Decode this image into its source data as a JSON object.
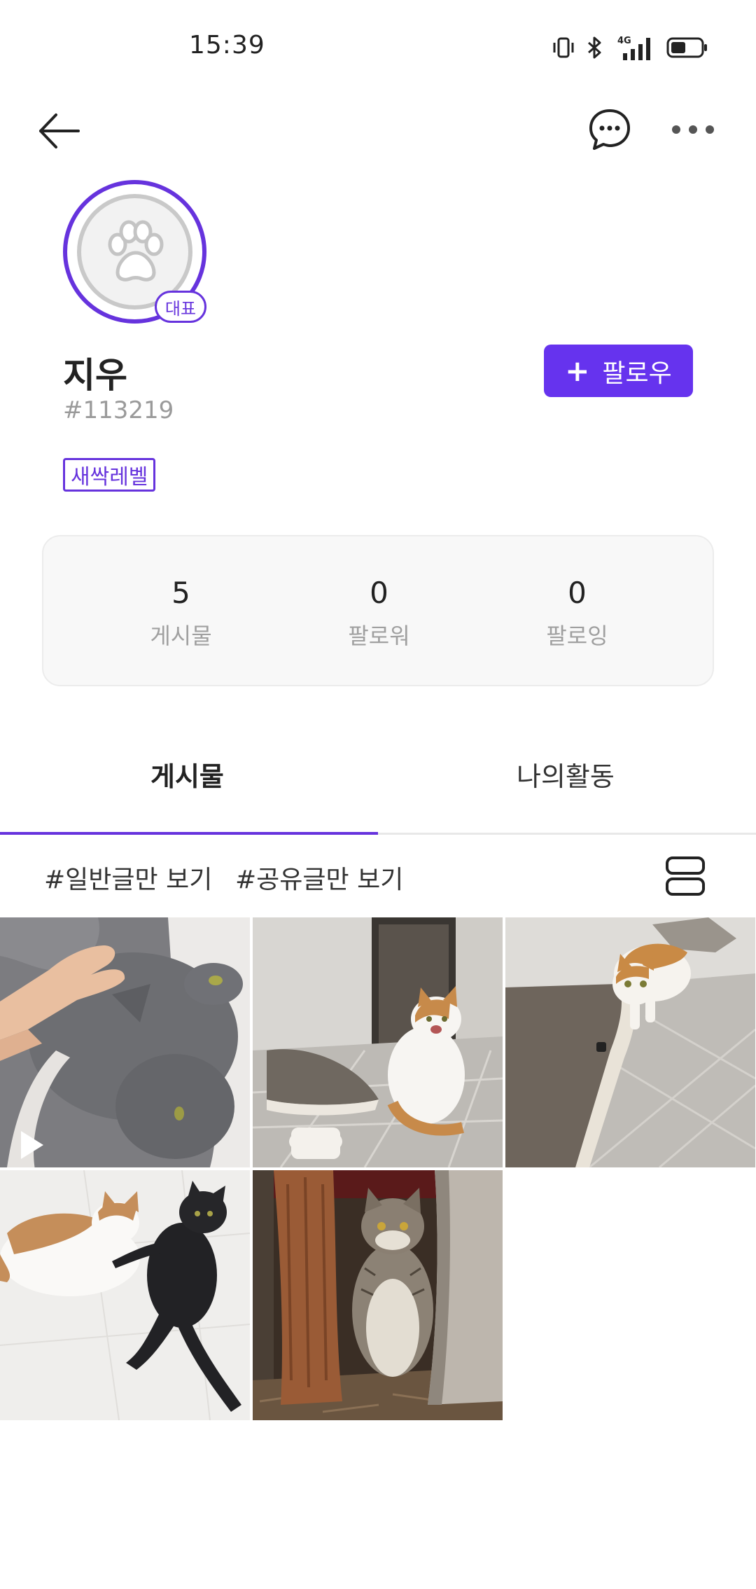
{
  "status_bar": {
    "time": "15:39",
    "icons": [
      "vibrate-icon",
      "bluetooth-icon",
      "signal-4g-icon",
      "battery-icon"
    ]
  },
  "topbar": {
    "icons": [
      "back-arrow-icon",
      "chat-bubble-icon",
      "more-dots-icon"
    ]
  },
  "profile": {
    "avatar_icon": "paw-icon",
    "rep_badge": "대표",
    "nickname": "지우",
    "user_id": "#113219",
    "level": "새싹레벨",
    "follow_label": "팔로우"
  },
  "stats": [
    {
      "value": "5",
      "label": "게시물"
    },
    {
      "value": "0",
      "label": "팔로워"
    },
    {
      "value": "0",
      "label": "팔로잉"
    }
  ],
  "tabs": [
    {
      "label": "게시물",
      "active": true
    },
    {
      "label": "나의활동",
      "active": false
    }
  ],
  "filters": {
    "general": "#일반글만 보기",
    "shared": "#공유글만 보기"
  },
  "posts": [
    {
      "kind": "video",
      "subject": "gray cat being petted"
    },
    {
      "kind": "photo",
      "subject": "white and orange cat sitting"
    },
    {
      "kind": "photo",
      "subject": "white and orange cat by scratcher"
    },
    {
      "kind": "photo",
      "subject": "white cat and black cat lying"
    },
    {
      "kind": "photo",
      "subject": "tabby cat between trees"
    }
  ],
  "colors": {
    "accent": "#6633dd",
    "follow_button": "#6633ee",
    "muted_text": "#9a9a9a",
    "stats_bg": "#f8f8f8"
  }
}
